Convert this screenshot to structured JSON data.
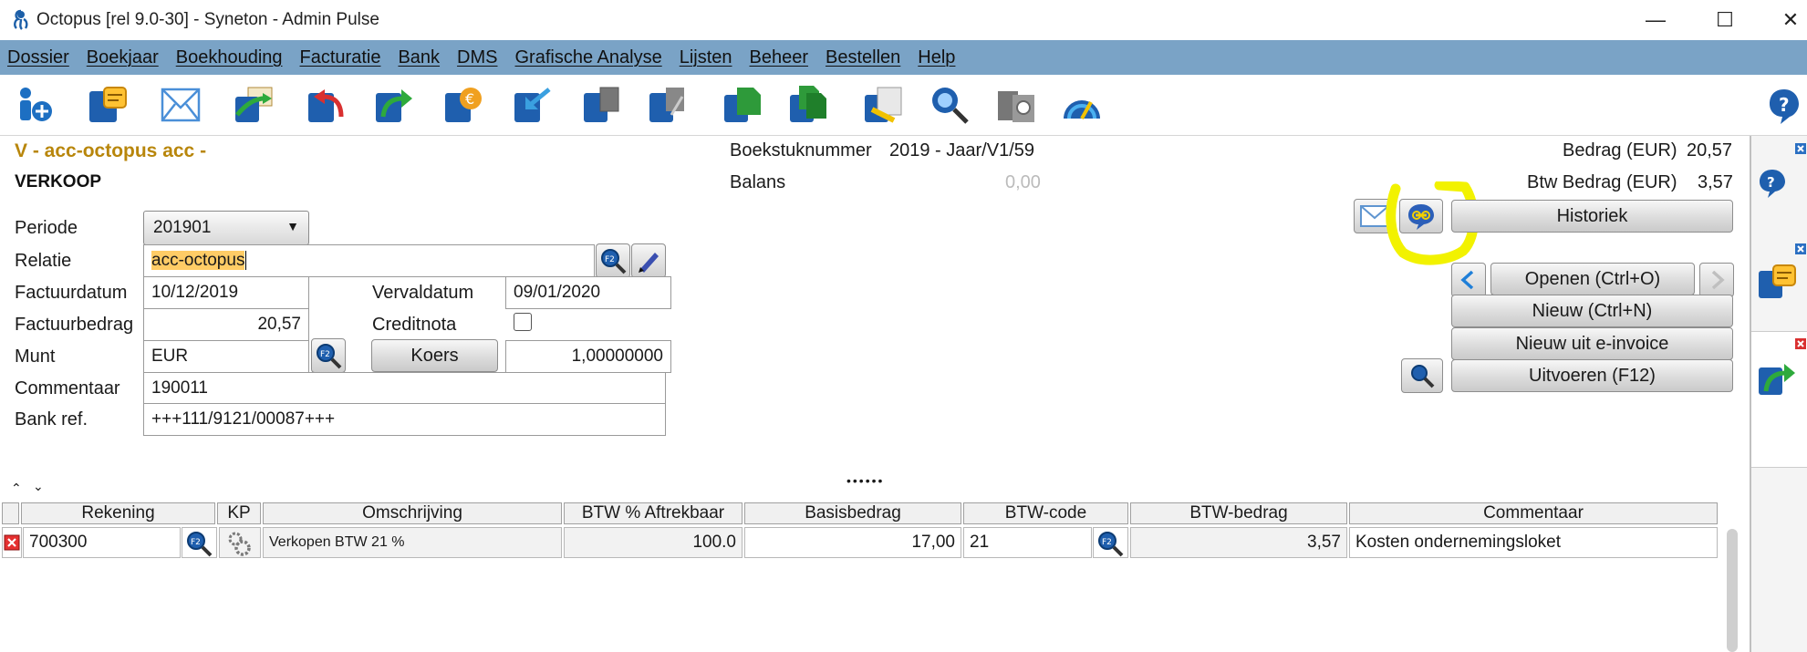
{
  "window": {
    "title": "Octopus [rel 9.0-30] - Syneton - Admin Pulse",
    "controls": {
      "minimize": "—",
      "maximize": "☐",
      "close": "✕"
    }
  },
  "menu": [
    "Dossier",
    "Boekjaar",
    "Boekhouding",
    "Facturatie",
    "Bank",
    "DMS",
    "Grafische Analyse",
    "Lijsten",
    "Beheer",
    "Bestellen",
    "Help"
  ],
  "toolbar_icons": [
    "info-add-icon",
    "notes-icon",
    "mail-icon",
    "chart-export-icon",
    "undo-book-icon",
    "forward-book-icon",
    "currency-book-icon",
    "import-book-icon",
    "copy-book-icon",
    "attach-book-icon",
    "green-document-icon",
    "green-documents-icon",
    "sign-document-icon",
    "search-document-icon",
    "settings-document-icon",
    "dashboard-icon",
    "help-icon"
  ],
  "doc": {
    "title": "V - acc-octopus acc -",
    "subtitle": "VERKOOP",
    "boekstuk_label": "Boekstuknummer",
    "boekstuk_value": "2019 - Jaar/V1/59",
    "balans_label": "Balans",
    "balans_value": "0,00",
    "bedrag_label": "Bedrag (EUR)",
    "bedrag_value": "20,57",
    "btw_label": "Btw Bedrag (EUR)",
    "btw_value": "3,57"
  },
  "form": {
    "periode_label": "Periode",
    "periode_value": "201901",
    "relatie_label": "Relatie",
    "relatie_value": "acc-octopus",
    "factuurdatum_label": "Factuurdatum",
    "factuurdatum_value": "10/12/2019",
    "vervaldatum_label": "Vervaldatum",
    "vervaldatum_value": "09/01/2020",
    "factuurbedrag_label": "Factuurbedrag",
    "factuurbedrag_value": "20,57",
    "creditnota_label": "Creditnota",
    "munt_label": "Munt",
    "munt_value": "EUR",
    "koers_label": "Koers",
    "koers_value": "1,00000000",
    "commentaar_label": "Commentaar",
    "commentaar_value": "190011",
    "bankref_label": "Bank ref.",
    "bankref_value": "+++111/9121/00087+++"
  },
  "actions": {
    "historiek": "Historiek",
    "openen": "Openen (Ctrl+O)",
    "nieuw": "Nieuw (Ctrl+N)",
    "nieuw_einvoice": "Nieuw uit e-invoice",
    "uitvoeren": "Uitvoeren (F12)"
  },
  "grid": {
    "headers": [
      "Rekening",
      "KP",
      "Omschrijving",
      "BTW % Aftrekbaar",
      "Basisbedrag",
      "BTW-code",
      "BTW-bedrag",
      "Commentaar"
    ],
    "rows": [
      {
        "rekening": "700300",
        "omschrijving": "Verkopen BTW 21 %",
        "btw_pct": "100.0",
        "basisbedrag": "17,00",
        "btw_code": "21",
        "btw_bedrag": "3,57",
        "commentaar": "Kosten ondernemingsloket"
      }
    ]
  },
  "colors": {
    "menubar": "#7aa3c6",
    "title_accent": "#b8860b",
    "highlight_marker": "#f2f200",
    "name_highlight": "#ffcc66"
  }
}
